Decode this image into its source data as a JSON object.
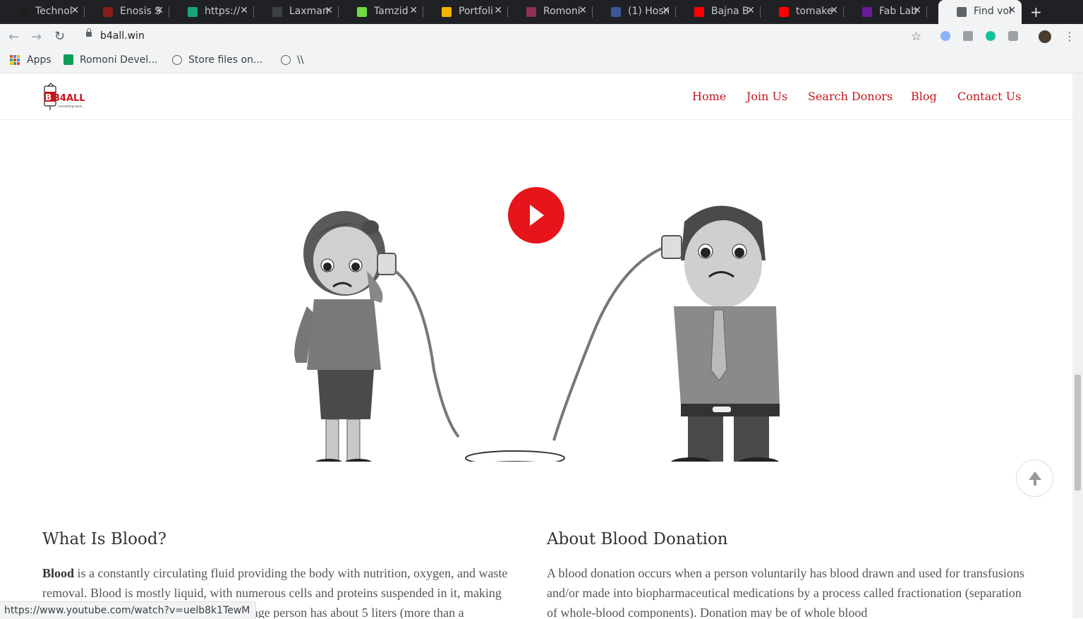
{
  "browser": {
    "tabs": [
      {
        "title": "Technol",
        "favicon_color": "#1f1f1f"
      },
      {
        "title": "Enosis S",
        "favicon_color": "#8b1a1a"
      },
      {
        "title": "https://",
        "favicon_color": "#18a47b"
      },
      {
        "title": "Laxman",
        "favicon_color": "#3c4043"
      },
      {
        "title": "Tamzid",
        "favicon_color": "#6fda44"
      },
      {
        "title": "Portfoli",
        "favicon_color": "#f4b400"
      },
      {
        "title": "Romoni",
        "favicon_color": "#8e3052"
      },
      {
        "title": "(1) Hosn",
        "favicon_color": "#3b5998"
      },
      {
        "title": "Bajna B",
        "favicon_color": "#ff0000"
      },
      {
        "title": "tomake",
        "favicon_color": "#ff0000"
      },
      {
        "title": "Fab Lab",
        "favicon_color": "#6a1b9a"
      },
      {
        "title": "Find vol",
        "favicon_color": "#5f6368",
        "active": true
      }
    ],
    "url": "b4all.win",
    "bookmarks": {
      "apps": "Apps",
      "items": [
        "Romoni Devel...",
        "Store files on...",
        "\\\\"
      ]
    },
    "status_url": "https://www.youtube.com/watch?v=uelb8k1TewM"
  },
  "site": {
    "logo_text": "B4ALL",
    "logo_tagline": "connecting souls...",
    "nav": [
      "Home",
      "Join Us",
      "Search Donors",
      "Blog",
      "Contact Us"
    ],
    "accent": "#c4161c",
    "sections": [
      {
        "heading": "What Is Blood?",
        "bold": "Blood",
        "body": " is a constantly circulating fluid providing the body with nutrition, oxygen, and waste removal. Blood is mostly liquid, with numerous cells and proteins suspended in it, making blood \"thicker\" than pure water. The average person has about 5 liters (more than a"
      },
      {
        "heading": "About Blood Donation",
        "body": "A blood donation occurs when a person voluntarily has blood drawn and used for transfusions and/or made into biopharmaceutical medications by a process called fractionation (separation of whole-blood components). Donation may be of whole blood"
      }
    ]
  }
}
